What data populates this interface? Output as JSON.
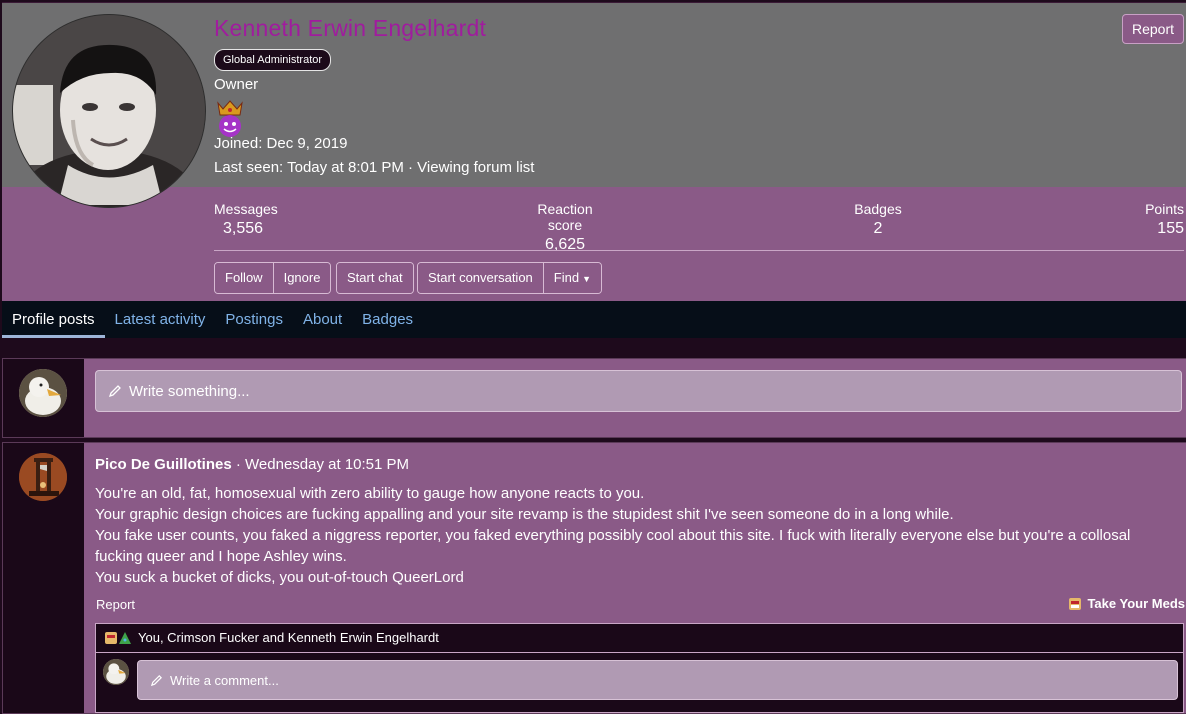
{
  "profile": {
    "name": "Kenneth Erwin Engelhardt",
    "banner": "Global Administrator",
    "title": "Owner",
    "joined": "Joined: Dec 9, 2019",
    "last_seen": "Last seen: Today at 8:01 PM · Viewing forum list",
    "report_label": "Report",
    "name_color": "#a01c9e"
  },
  "stats": {
    "messages_label": "Messages",
    "messages_value": "3,556",
    "reaction_label": "Reaction score",
    "reaction_value": "6,625",
    "badges_label": "Badges",
    "badges_value": "2",
    "points_label": "Points",
    "points_value": "155"
  },
  "actions": {
    "follow": "Follow",
    "ignore": "Ignore",
    "start_chat": "Start chat",
    "start_conversation": "Start conversation",
    "find": "Find"
  },
  "tabs": [
    "Profile posts",
    "Latest activity",
    "Postings",
    "About",
    "Badges"
  ],
  "composer": {
    "placeholder": "Write something..."
  },
  "post": {
    "author": "Pico De Guillotines",
    "time": " · Wednesday at 10:51 PM",
    "lines": [
      "You're an old, fat, homosexual with zero ability to gauge how anyone reacts to you.",
      "Your graphic design choices are fucking appalling and your site revamp is the stupidest shit I've seen someone do in a long while.",
      "You fake user counts, you faked a niggress reporter, you faked everything possibly cool about this site. I fuck with literally everyone else but you're a collosal fucking queer and I hope Ashley wins.",
      "You suck a bucket of dicks, you out-of-touch QueerLord"
    ],
    "report_label": "Report",
    "reaction_label": "Take Your Meds",
    "reacted_by": "You, Crimson Fucker and Kenneth Erwin Engelhardt",
    "comment_placeholder": "Write a comment..."
  },
  "colors": {
    "profile_band": "#8a5a87",
    "header_gray": "#6f6f70",
    "tab_bar": "#060e18",
    "tab_link": "#80b3e8"
  }
}
